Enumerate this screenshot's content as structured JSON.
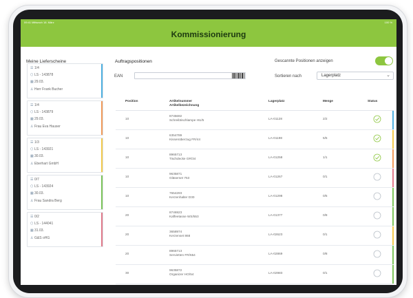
{
  "status_bar": {
    "time": "09:41  Mittwoch 18. März",
    "battery": "100 %"
  },
  "app_title": "Kommissionierung",
  "sidebar": {
    "title": "Meine Lieferscheine",
    "cards": [
      {
        "count": "1/4",
        "ls": "LS - 143878",
        "date": "29.03.",
        "name": "Herr Frank Bucher",
        "color": "#4fb0e0"
      },
      {
        "count": "1/4",
        "ls": "LS - 143879",
        "date": "29.03.",
        "name": "Frau Eva Hauser",
        "color": "#f09a5a"
      },
      {
        "count": "1/3",
        "ls": "LS - 143921",
        "date": "30.03.",
        "name": "Eberhart GmbH",
        "color": "#f2c94c"
      },
      {
        "count": "0/7",
        "ls": "LS - 143924",
        "date": "30.03.",
        "name": "Frau Sandra Berg",
        "color": "#7cc45a"
      },
      {
        "count": "0/2",
        "ls": "LS - 144041",
        "date": "31.03.",
        "name": "G&S oHG",
        "color": "#e07a8a"
      }
    ]
  },
  "main": {
    "section_title": "Auftragspositionen",
    "ean_label": "EAN",
    "ean_value": "",
    "toggle_label": "Gescannte Positionen anzeigen",
    "toggle_on": true,
    "sort_label": "Sortieren nach",
    "sort_value": "Lagerplatz"
  },
  "table": {
    "headers": {
      "position": "Position",
      "artikel_line1": "Artikelnummer",
      "artikel_line2": "Artikelbezeichnung",
      "lagerplatz": "Lagerplatz",
      "menge": "Menge",
      "status": "Status"
    },
    "rows": [
      {
        "position": "10",
        "nummer": "8745692",
        "bezeichnung": "Schreibtischlampe HU/5",
        "lagerplatz": "LA-01128",
        "menge": "2/2",
        "done": true,
        "color": "#4fb0e0"
      },
      {
        "position": "10",
        "nummer": "6354789",
        "bezeichnung": "Kissenüberzug FR/44",
        "lagerplatz": "LA-01198",
        "menge": "5/5",
        "done": true,
        "color": "#f2c94c"
      },
      {
        "position": "10",
        "nummer": "8965713",
        "bezeichnung": "Tischdecke GR/34",
        "lagerplatz": "LA-01258",
        "menge": "1/1",
        "done": true,
        "color": "#f09a5a"
      },
      {
        "position": "10",
        "nummer": "9635871",
        "bezeichnung": "Gläserset 753",
        "lagerplatz": "LA-01267",
        "menge": "0/1",
        "done": false,
        "color": "#e07a8a"
      },
      {
        "position": "10",
        "nummer": "7654293",
        "bezeichnung": "Kerzenhalter D30",
        "lagerplatz": "LA-01298",
        "menge": "0/5",
        "done": false,
        "color": "#7cc45a"
      },
      {
        "position": "20",
        "nummer": "8746923",
        "bezeichnung": "Kaffeetasse WS/553",
        "lagerplatz": "LA-01377",
        "menge": "0/8",
        "done": false,
        "color": "#7cc45a"
      },
      {
        "position": "20",
        "nummer": "3658974",
        "bezeichnung": "Kerzenset 868",
        "lagerplatz": "LA-02623",
        "menge": "0/1",
        "done": false,
        "color": "#f2c94c"
      },
      {
        "position": "20",
        "nummer": "8965713",
        "bezeichnung": "Servietten FR/654",
        "lagerplatz": "LA-02869",
        "menge": "0/8",
        "done": false,
        "color": "#7cc45a"
      },
      {
        "position": "30",
        "nummer": "9635872",
        "bezeichnung": "Organizer HO/54",
        "lagerplatz": "LA-02983",
        "menge": "0/1",
        "done": false,
        "color": "#7cc45a"
      }
    ]
  },
  "colors": {
    "brand_green": "#8dc63f",
    "title_text": "#1d3a10",
    "check": "#8dc63f",
    "empty_circle": "#b9c0c8"
  }
}
